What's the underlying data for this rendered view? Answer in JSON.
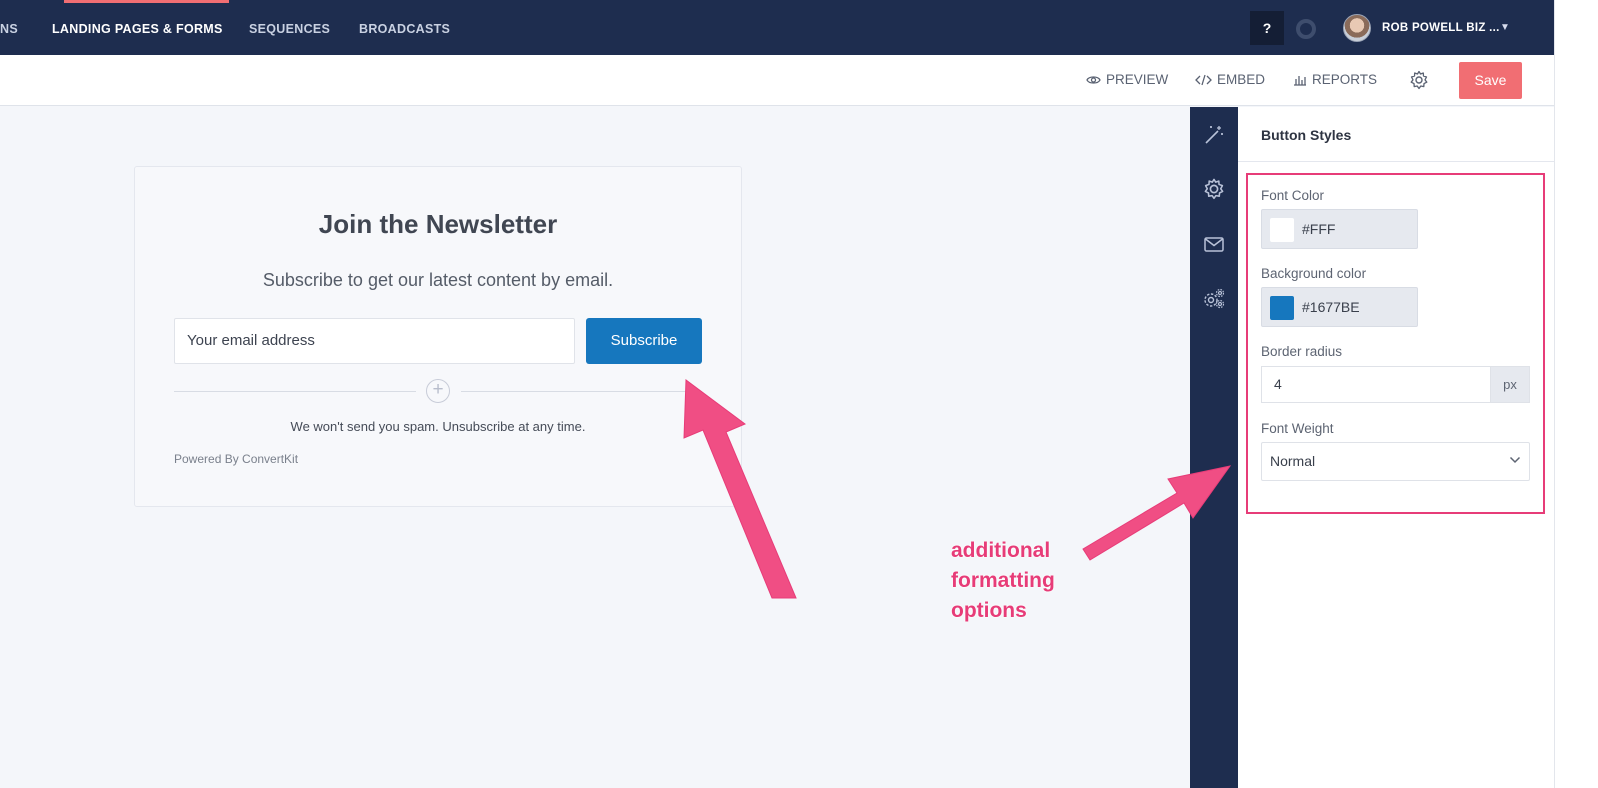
{
  "topnav": {
    "items": [
      {
        "label": "NS"
      },
      {
        "label": "LANDING PAGES & FORMS"
      },
      {
        "label": "SEQUENCES"
      },
      {
        "label": "BROADCASTS"
      }
    ],
    "help_label": "?",
    "user_name": "ROB POWELL BIZ ..."
  },
  "toolbar": {
    "preview_label": "PREVIEW",
    "embed_label": "EMBED",
    "reports_label": "REPORTS",
    "save_label": "Save"
  },
  "form": {
    "title": "Join the Newsletter",
    "subtitle": "Subscribe to get our latest content by email.",
    "email_placeholder": "Your email address",
    "button_label": "Subscribe",
    "spam_note": "We won't send you spam. Unsubscribe at any time.",
    "powered_by": "Powered By ConvertKit"
  },
  "panel": {
    "title": "Button Styles",
    "font_color_label": "Font Color",
    "font_color_value": "#FFF",
    "bg_color_label": "Background color",
    "bg_color_value": "#1677BE",
    "border_radius_label": "Border radius",
    "border_radius_value": "4",
    "border_radius_unit": "px",
    "font_weight_label": "Font Weight",
    "font_weight_value": "Normal"
  },
  "annotation": {
    "lines": [
      "additional",
      "formatting",
      "options"
    ]
  },
  "colors": {
    "nav_bg": "#1e2d4f",
    "accent": "#f16e73",
    "button_blue": "#1677be",
    "annotation_pink": "#e73c78"
  },
  "icons": {
    "preview": "eye-icon",
    "embed": "code-icon",
    "reports": "bar-chart-icon",
    "settings": "gear-icon",
    "rail": [
      "magic-wand-icon",
      "gear-icon",
      "envelope-icon",
      "gears-icon"
    ]
  }
}
